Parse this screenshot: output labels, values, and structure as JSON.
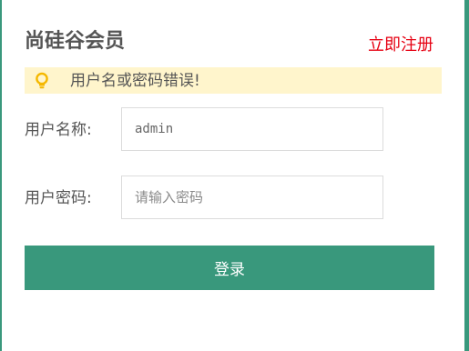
{
  "header": {
    "title": "尚硅谷会员",
    "register_link": "立即注册"
  },
  "alert": {
    "icon": "lightbulb-icon",
    "message": "用户名或密码错误!"
  },
  "form": {
    "username_label": "用户名称:",
    "username_value": "admin",
    "password_label": "用户密码:",
    "password_placeholder": "请输入密码",
    "submit_label": "登录"
  },
  "colors": {
    "accent": "#39987c",
    "link": "#e60012",
    "alert_bg": "#fff5cc",
    "icon": "#f5b800"
  }
}
